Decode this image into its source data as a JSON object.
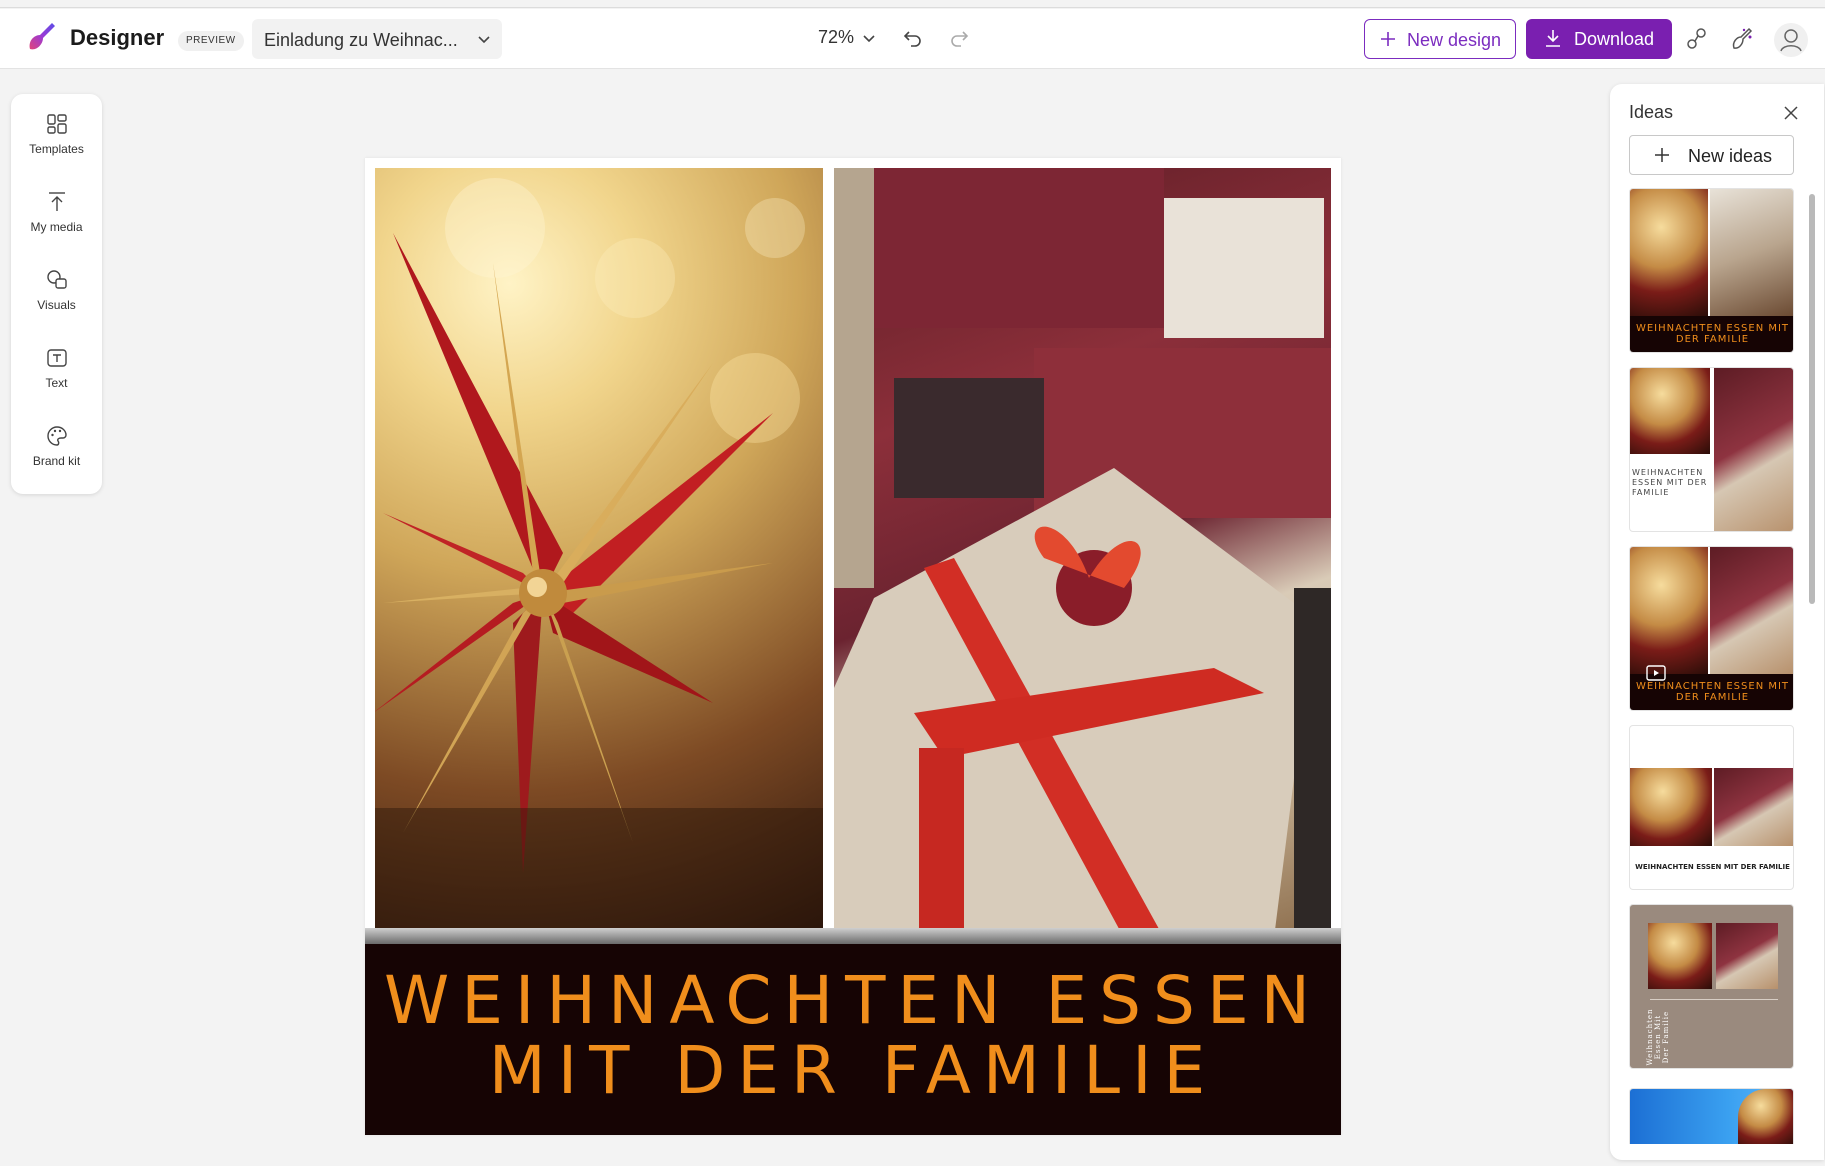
{
  "header": {
    "app_name": "Designer",
    "preview_badge": "PREVIEW",
    "document_title": "Einladung zu Weihnac...",
    "zoom_level": "72%",
    "new_design_label": "New design",
    "download_label": "Download",
    "accent_color": "#7a1fb0"
  },
  "toolbar": {
    "items": [
      {
        "label": "Templates",
        "icon": "templates-icon"
      },
      {
        "label": "My media",
        "icon": "upload-icon"
      },
      {
        "label": "Visuals",
        "icon": "visuals-icon"
      },
      {
        "label": "Text",
        "icon": "text-icon"
      },
      {
        "label": "Brand kit",
        "icon": "palette-icon"
      }
    ]
  },
  "canvas": {
    "title_line1": "WEIHNACHTEN ESSEN",
    "title_line2": "MIT DER FAMILIE",
    "title_color": "#f08e1c",
    "band_color": "#160404"
  },
  "ideas_panel": {
    "title": "Ideas",
    "new_ideas_label": "New ideas",
    "thumbnails": [
      {
        "caption": "WEIHNACHTEN ESSEN MIT DER FAMILIE"
      },
      {
        "caption": "WEIHNACHTEN ESSEN MIT DER FAMILIE"
      },
      {
        "caption": "WEIHNACHTEN ESSEN MIT DER FAMILIE"
      },
      {
        "caption": "WEIHNACHTEN ESSEN MIT DER FAMILIE"
      },
      {
        "caption": "Weihnachten Essen Mit Der Familie"
      }
    ]
  }
}
